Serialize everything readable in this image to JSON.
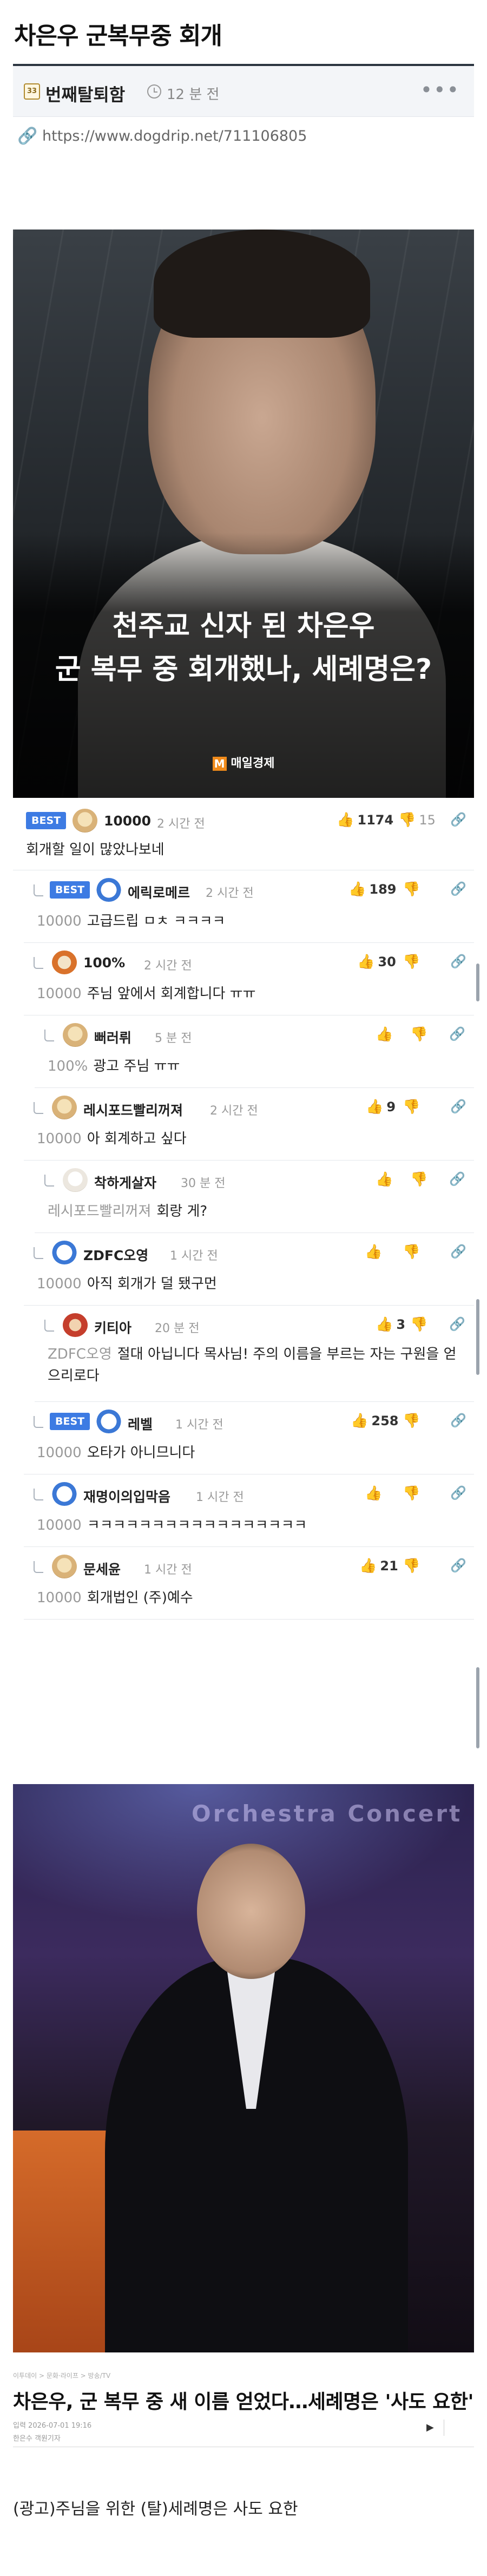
{
  "post": {
    "title": "차은우 군복무중 회개",
    "category_icon": "33",
    "category": "번째탈퇴함",
    "time": "12 분 전",
    "more": "•••",
    "url": "https://www.dogdrip.net/711106805"
  },
  "image1": {
    "caption_line1": "천주교 신자 된 차은우",
    "caption_line2": "군 복무 중 회개했나, 세례명은?",
    "brand": "매일경제"
  },
  "comments": [
    {
      "best": "BEST",
      "nick": "10000",
      "ago": "2 시간 전",
      "likes": "1174",
      "dislikes": "15",
      "reply_to": "",
      "text": "회개할 일이 많았나보네"
    },
    {
      "best": "BEST",
      "nick": "에릭로메르",
      "ago": "2 시간 전",
      "likes": "189",
      "dislikes": "",
      "reply_to": "10000",
      "text": "고급드립 ㅁㅊ ㅋㅋㅋㅋ"
    },
    {
      "best": "",
      "nick": "100%",
      "ago": "2 시간 전",
      "likes": "30",
      "dislikes": "",
      "reply_to": "10000",
      "text": "주님 앞에서 회계합니다 ㅠㅠ"
    },
    {
      "best": "",
      "nick": "뻐러뤼",
      "ago": "5 분 전",
      "likes": "",
      "dislikes": "",
      "reply_to": "100%",
      "text": "광고 주님 ㅠㅠ"
    },
    {
      "best": "",
      "nick": "레시포드빨리꺼져",
      "ago": "2 시간 전",
      "likes": "9",
      "dislikes": "",
      "reply_to": "10000",
      "text": "아 회계하고 싶다"
    },
    {
      "best": "",
      "nick": "착하게살자",
      "ago": "30 분 전",
      "likes": "",
      "dislikes": "",
      "reply_to": "레시포드빨리꺼져",
      "text": "회랑 게?"
    },
    {
      "best": "",
      "nick": "ZDFC오영",
      "ago": "1 시간 전",
      "likes": "",
      "dislikes": "",
      "reply_to": "10000",
      "text": "아직 회개가 덜 됐구먼"
    },
    {
      "best": "",
      "nick": "키티아",
      "ago": "20 분 전",
      "likes": "3",
      "dislikes": "",
      "reply_to": "ZDFC오영",
      "text": "절대 아닙니다 목사님! 주의 이름을 부르는 자는 구원을 얻으리로다"
    },
    {
      "best": "BEST",
      "nick": "레벨",
      "ago": "1 시간 전",
      "likes": "258",
      "dislikes": "",
      "reply_to": "10000",
      "text": "오타가 아니므니다"
    },
    {
      "best": "",
      "nick": "재명이의입막음",
      "ago": "1 시간 전",
      "likes": "",
      "dislikes": "",
      "reply_to": "10000",
      "text": "ㅋㅋㅋㅋㅋㅋㅋㅋㅋㅋㅋㅋㅋㅋㅋㅋㅋ"
    },
    {
      "best": "",
      "nick": "문세윤",
      "ago": "1 시간 전",
      "likes": "21",
      "dislikes": "",
      "reply_to": "10000",
      "text": "회개법인 (주)예수"
    }
  ],
  "image2": {
    "banner": "Orchestra Concert"
  },
  "article": {
    "mini": "이투데이 > 문화·라이프 > 방송/TV",
    "title": "차은우, 군 복무 중 새 이름 얻었다…세례명은 '사도 요한'",
    "date": "입력 2026-07-01 19:16",
    "byline": "한은수 객원기자"
  },
  "closing": "(광고)주님을 위한 (탈)세례명은 사도 요한",
  "icons": {
    "link": "link-icon",
    "clock": "clock-icon",
    "thumbs_up": "thumbs-up-icon",
    "thumbs_down": "thumbs-down-icon",
    "paperclip": "paperclip-icon",
    "play": "play-icon"
  },
  "colors": {
    "best_badge": "#3d7be3",
    "title_rule": "#2c3540",
    "meta_bg": "#f3f5f8",
    "brand_orange": "#f08a1a"
  }
}
